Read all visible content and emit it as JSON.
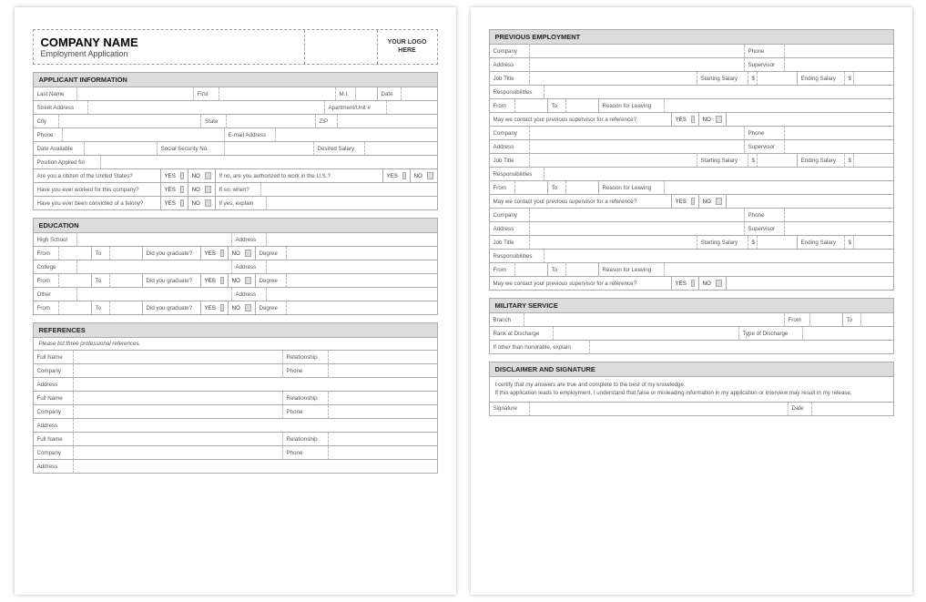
{
  "header": {
    "company": "COMPANY NAME",
    "subtitle": "Employment Application",
    "logo": "YOUR LOGO HERE"
  },
  "sections": {
    "applicant": "APPLICANT INFORMATION",
    "education": "EDUCATION",
    "references": "REFERENCES",
    "prevEmployment": "PREVIOUS EMPLOYMENT",
    "military": "MILITARY SERVICE",
    "disclaimer": "DISCLAIMER AND SIGNATURE"
  },
  "labels": {
    "lastName": "Last Name",
    "first": "First",
    "mi": "M.I.",
    "date": "Date",
    "streetAddress": "Street Address",
    "aptUnit": "Apartment/Unit #",
    "city": "City",
    "state": "State",
    "zip": "ZIP",
    "phone": "Phone",
    "email": "E-mail Address",
    "dateAvailable": "Date Available",
    "ssn": "Social Security No.",
    "desiredSalary": "Desired Salary",
    "positionApplied": "Position Applied for",
    "citizenQ": "Are you a citizen of the United States?",
    "authorizedQ": "If no, are you authorized to work in the U.S.?",
    "workedBeforeQ": "Have you ever worked for this company?",
    "ifSoWhen": "If so, when?",
    "felonyQ": "Have you ever been convicted of a felony?",
    "ifYesExplain": "If yes, explain",
    "highSchool": "High School",
    "college": "College",
    "other": "Other",
    "address": "Address",
    "from": "From",
    "to": "To",
    "didGraduate": "Did you graduate?",
    "degree": "Degree",
    "refsNote": "Please list three professional references.",
    "fullName": "Full Name",
    "relationship": "Relationship",
    "company": "Company",
    "supervisor": "Supervisor",
    "jobTitle": "Job Title",
    "startingSalary": "Starting Salary",
    "endingSalary": "Ending Salary",
    "dollar": "$",
    "responsibilities": "Responsibilities",
    "reasonLeaving": "Reason for Leaving",
    "contactSupervisorQ": "May we contact your previous supervisor for a reference?",
    "branch": "Branch",
    "rankDischarge": "Rank at Discharge",
    "typeDischarge": "Type of Discharge",
    "otherHonorable": "If other than honorable, explain",
    "disclaim1": "I certify that my answers are true and complete to the best of my knowledge.",
    "disclaim2": "If this application leads to employment, I understand that false or misleading information in my application or interview may result in my release.",
    "signature": "Signature",
    "yes": "YES",
    "no": "NO"
  }
}
